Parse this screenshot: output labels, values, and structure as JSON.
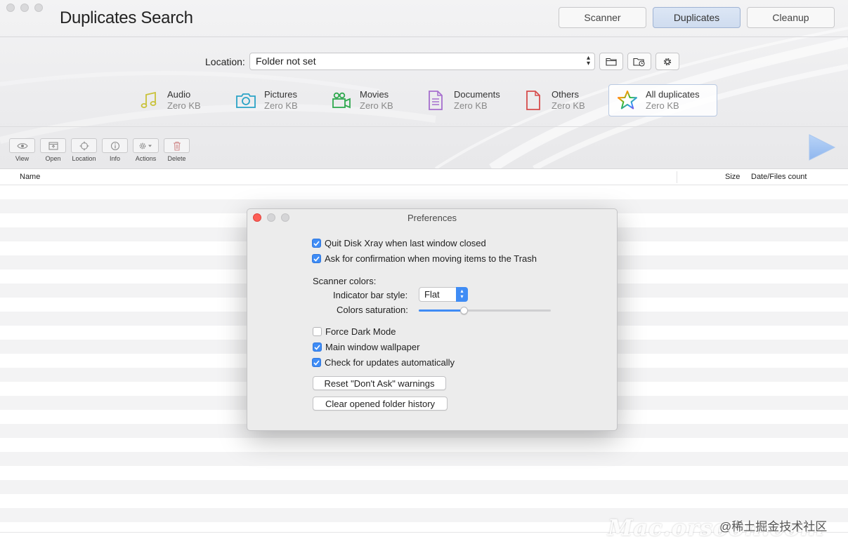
{
  "window": {
    "title": "Duplicates Search"
  },
  "tabs": [
    {
      "label": "Scanner",
      "active": false
    },
    {
      "label": "Duplicates",
      "active": true
    },
    {
      "label": "Cleanup",
      "active": false
    }
  ],
  "location": {
    "label": "Location:",
    "value": "Folder not set"
  },
  "categories": [
    {
      "name": "Audio",
      "size": "Zero KB",
      "icon": "music-note-icon",
      "color": "#c9c23a"
    },
    {
      "name": "Pictures",
      "size": "Zero KB",
      "icon": "camera-icon",
      "color": "#2aa3c6"
    },
    {
      "name": "Movies",
      "size": "Zero KB",
      "icon": "movie-camera-icon",
      "color": "#2fa84f"
    },
    {
      "name": "Documents",
      "size": "Zero KB",
      "icon": "document-icon",
      "color": "#a66fce"
    },
    {
      "name": "Others",
      "size": "Zero KB",
      "icon": "file-icon",
      "color": "#d64c4c"
    },
    {
      "name": "All duplicates",
      "size": "Zero KB",
      "icon": "star-icon",
      "selected": true
    }
  ],
  "toolbar": {
    "view": "View",
    "open": "Open",
    "location": "Location",
    "info": "Info",
    "actions": "Actions",
    "delete": "Delete"
  },
  "columns": {
    "name": "Name",
    "size": "Size",
    "date": "Date/Files count"
  },
  "preferences": {
    "title": "Preferences",
    "quit_on_close": {
      "label": "Quit Disk Xray when last window closed",
      "checked": true
    },
    "confirm_trash": {
      "label": "Ask for confirmation when moving items to the Trash",
      "checked": true
    },
    "scanner_colors_label": "Scanner colors:",
    "indicator_label": "Indicator bar style:",
    "indicator_value": "Flat",
    "saturation_label": "Colors saturation:",
    "saturation_value": 0.34,
    "force_dark": {
      "label": "Force Dark Mode",
      "checked": false
    },
    "wallpaper": {
      "label": "Main window wallpaper",
      "checked": true
    },
    "updates": {
      "label": "Check for updates automatically",
      "checked": true
    },
    "reset_button": "Reset \"Don't Ask\" warnings",
    "clear_button": "Clear opened folder history"
  },
  "watermark": {
    "brand": "Mac.orsoon.com",
    "cn": "@稀土掘金技术社区"
  },
  "colors": {
    "accent": "#3f8cf5",
    "close": "#fd5f57"
  }
}
